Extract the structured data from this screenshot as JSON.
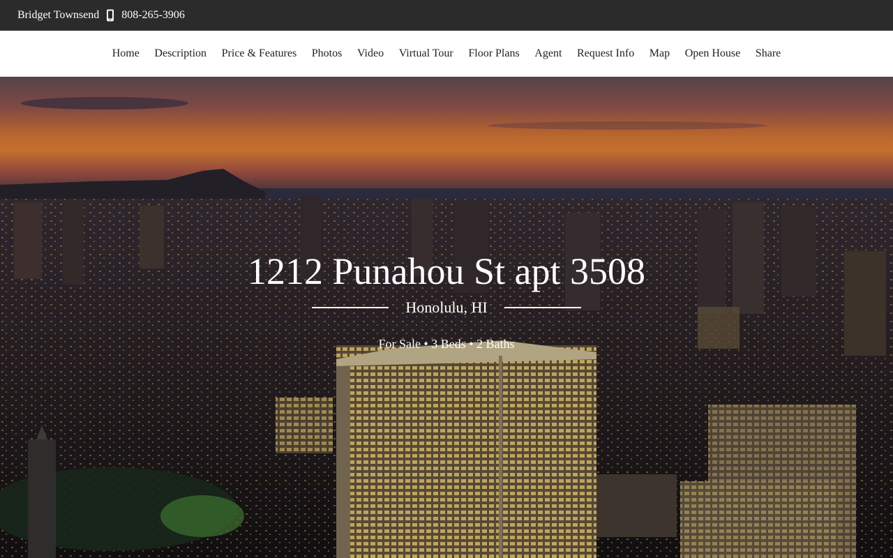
{
  "topbar": {
    "agent_name": "Bridget Townsend",
    "phone": "808-265-3906",
    "phone_icon": "mobile-phone-icon"
  },
  "nav": {
    "items": [
      "Home",
      "Description",
      "Price & Features",
      "Photos",
      "Video",
      "Virtual Tour",
      "Floor Plans",
      "Agent",
      "Request Info",
      "Map",
      "Open House",
      "Share"
    ]
  },
  "hero": {
    "address": "1212 Punahou St apt 3508",
    "city": "Honolulu, HI",
    "summary": "For Sale • 3 Beds • 2 Baths",
    "image": "sunset-city-skyline-photo"
  },
  "colors": {
    "topbar_bg": "#2b2b2b",
    "nav_bg": "#ffffff",
    "text_light": "#ffffff",
    "text_dark": "#222222"
  }
}
